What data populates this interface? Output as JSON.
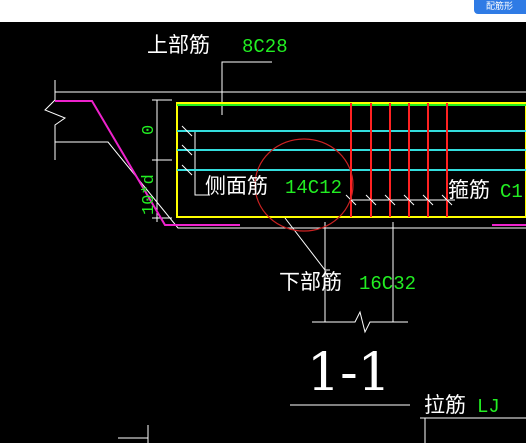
{
  "toolbar": {
    "button_label": "配筋形"
  },
  "labels": {
    "top_bar_title": "上部筋",
    "top_bar_value": "8C28",
    "side_bar_title": "侧面筋",
    "side_bar_value": "14C12",
    "stirrup_title": "箍筋",
    "stirrup_value": "C1",
    "bottom_bar_title": "下部筋",
    "bottom_bar_value": "16C32",
    "section_mark": "1-1",
    "tie_bar_title": "拉筋",
    "tie_bar_value": "LJ",
    "dim_zero": "0",
    "dim_anchor": "10*d"
  },
  "colors": {
    "background": "#000000",
    "outline": "#ffffff",
    "concrete_edge": "#ffff00",
    "top_bar": "#22ee22",
    "side_bar": "#33dddd",
    "stirrup": "#ff2222",
    "bent_bar": "#ee22cc",
    "callout_circle": "#cc2222",
    "value_text": "#22ee22"
  }
}
